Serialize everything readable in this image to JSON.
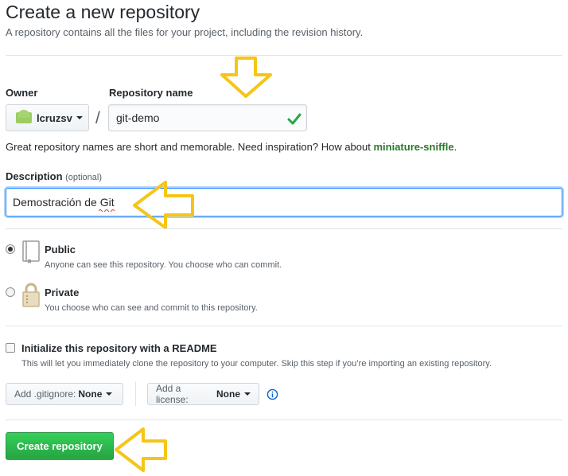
{
  "header": {
    "title": "Create a new repository",
    "subtitle": "A repository contains all the files for your project, including the revision history."
  },
  "owner": {
    "label": "Owner",
    "value": "lcruzsv"
  },
  "repo_name": {
    "label": "Repository name",
    "value": "git-demo"
  },
  "separator": "/",
  "hint": {
    "prefix": "Great repository names are short and memorable. Need inspiration? How about ",
    "suggestion": "miniature-sniffle",
    "suffix": "."
  },
  "description": {
    "label": "Description",
    "optional": "(optional)",
    "value": "Demostración de Git"
  },
  "visibility": {
    "public": {
      "title": "Public",
      "desc": "Anyone can see this repository. You choose who can commit.",
      "checked": true
    },
    "private": {
      "title": "Private",
      "desc": "You choose who can see and commit to this repository.",
      "checked": false
    }
  },
  "readme": {
    "title": "Initialize this repository with a README",
    "desc": "This will let you immediately clone the repository to your computer. Skip this step if you’re importing an existing repository.",
    "checked": false
  },
  "gitignore": {
    "label": "Add .gitignore:",
    "value": "None"
  },
  "license": {
    "label": "Add a license:",
    "value": "None"
  },
  "create_button": "Create repository",
  "colors": {
    "accent_green": "#28a745",
    "annotation_arrow": "#f5c518",
    "focus_blue": "#2188ff"
  },
  "icons": [
    "owner-avatar-icon",
    "check-icon",
    "repo-book-icon",
    "lock-icon",
    "info-icon",
    "caret-down-icon",
    "arrow-annotation"
  ]
}
